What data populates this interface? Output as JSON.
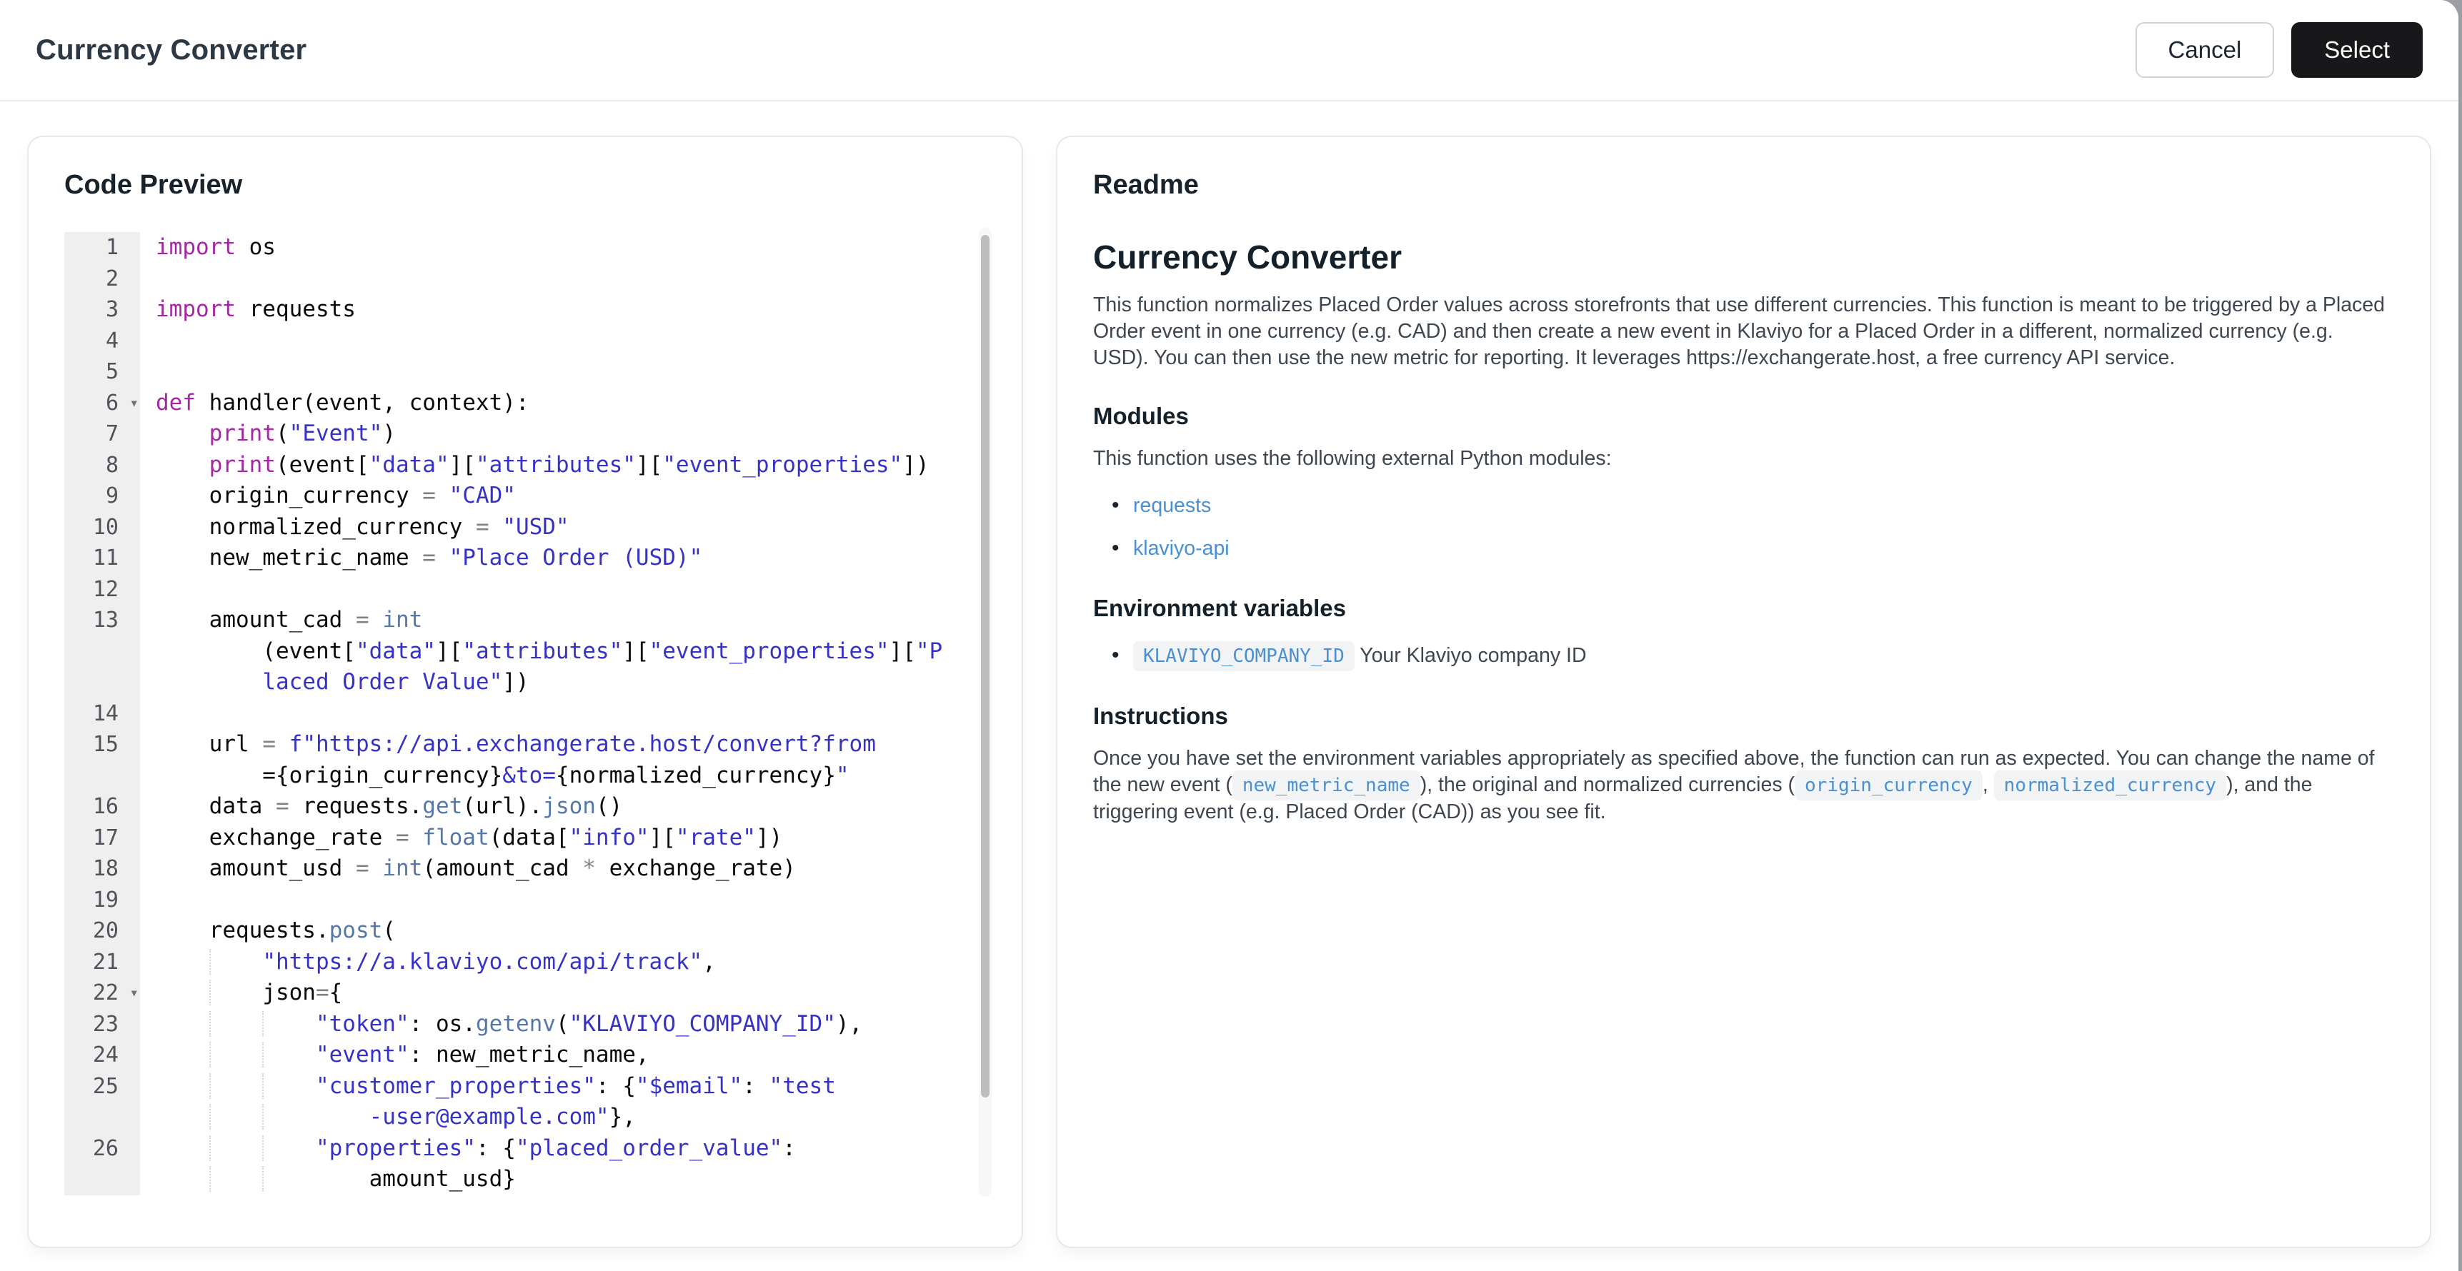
{
  "header": {
    "title": "Currency Converter",
    "cancel_label": "Cancel",
    "select_label": "Select"
  },
  "code": {
    "panel_title": "Code Preview",
    "rows": [
      {
        "n": "1",
        "segs": [
          [
            "k",
            "import"
          ],
          [
            "p",
            " os"
          ]
        ]
      },
      {
        "n": "2",
        "segs": []
      },
      {
        "n": "3",
        "segs": [
          [
            "k",
            "import"
          ],
          [
            "p",
            " requests"
          ]
        ]
      },
      {
        "n": "4",
        "segs": []
      },
      {
        "n": "5",
        "segs": []
      },
      {
        "n": "6",
        "fold": true,
        "segs": [
          [
            "k",
            "def"
          ],
          [
            "p",
            " handler(event, context):"
          ]
        ]
      },
      {
        "n": "7",
        "segs": [
          [
            "p",
            "    "
          ],
          [
            "k",
            "print"
          ],
          [
            "p",
            "("
          ],
          [
            "s",
            "\"Event\""
          ],
          [
            "p",
            ")"
          ]
        ]
      },
      {
        "n": "8",
        "segs": [
          [
            "p",
            "    "
          ],
          [
            "k",
            "print"
          ],
          [
            "p",
            "(event["
          ],
          [
            "s",
            "\"data\""
          ],
          [
            "p",
            "]["
          ],
          [
            "s",
            "\"attributes\""
          ],
          [
            "p",
            "]["
          ],
          [
            "s",
            "\"event_properties\""
          ],
          [
            "p",
            "])"
          ]
        ]
      },
      {
        "n": "9",
        "segs": [
          [
            "p",
            "    origin_currency "
          ],
          [
            "o",
            "="
          ],
          [
            "p",
            " "
          ],
          [
            "s",
            "\"CAD\""
          ]
        ]
      },
      {
        "n": "10",
        "segs": [
          [
            "p",
            "    normalized_currency "
          ],
          [
            "o",
            "="
          ],
          [
            "p",
            " "
          ],
          [
            "s",
            "\"USD\""
          ]
        ]
      },
      {
        "n": "11",
        "segs": [
          [
            "p",
            "    new_metric_name "
          ],
          [
            "o",
            "="
          ],
          [
            "p",
            " "
          ],
          [
            "s",
            "\"Place Order (USD)\""
          ]
        ]
      },
      {
        "n": "12",
        "segs": []
      },
      {
        "n": "13",
        "segs": [
          [
            "p",
            "    amount_cad "
          ],
          [
            "o",
            "="
          ],
          [
            "p",
            " "
          ],
          [
            "b",
            "int"
          ]
        ]
      },
      {
        "n": "",
        "segs": [
          [
            "p",
            "        (event["
          ],
          [
            "s",
            "\"data\""
          ],
          [
            "p",
            "]["
          ],
          [
            "s",
            "\"attributes\""
          ],
          [
            "p",
            "]["
          ],
          [
            "s",
            "\"event_properties\""
          ],
          [
            "p",
            "]["
          ],
          [
            "s",
            "\"P"
          ]
        ]
      },
      {
        "n": "",
        "segs": [
          [
            "p",
            "        "
          ],
          [
            "s",
            "laced Order Value\""
          ],
          [
            "p",
            "])"
          ]
        ]
      },
      {
        "n": "14",
        "segs": []
      },
      {
        "n": "15",
        "segs": [
          [
            "p",
            "    url "
          ],
          [
            "o",
            "="
          ],
          [
            "p",
            " "
          ],
          [
            "s",
            "f\"https://api.exchangerate.host/convert?from"
          ]
        ]
      },
      {
        "n": "",
        "segs": [
          [
            "p",
            "        ={origin_currency}"
          ],
          [
            "s",
            "&to="
          ],
          [
            "p",
            "{normalized_currency}"
          ],
          [
            "s",
            "\""
          ]
        ]
      },
      {
        "n": "16",
        "segs": [
          [
            "p",
            "    data "
          ],
          [
            "o",
            "="
          ],
          [
            "p",
            " requests."
          ],
          [
            "b",
            "get"
          ],
          [
            "p",
            "(url)."
          ],
          [
            "b",
            "json"
          ],
          [
            "p",
            "()"
          ]
        ]
      },
      {
        "n": "17",
        "segs": [
          [
            "p",
            "    exchange_rate "
          ],
          [
            "o",
            "="
          ],
          [
            "p",
            " "
          ],
          [
            "b",
            "float"
          ],
          [
            "p",
            "(data["
          ],
          [
            "s",
            "\"info\""
          ],
          [
            "p",
            "]["
          ],
          [
            "s",
            "\"rate\""
          ],
          [
            "p",
            "])"
          ]
        ]
      },
      {
        "n": "18",
        "segs": [
          [
            "p",
            "    amount_usd "
          ],
          [
            "o",
            "="
          ],
          [
            "p",
            " "
          ],
          [
            "b",
            "int"
          ],
          [
            "p",
            "(amount_cad "
          ],
          [
            "o",
            "*"
          ],
          [
            "p",
            " exchange_rate)"
          ]
        ]
      },
      {
        "n": "19",
        "segs": []
      },
      {
        "n": "20",
        "segs": [
          [
            "p",
            "    requests."
          ],
          [
            "b",
            "post"
          ],
          [
            "p",
            "("
          ]
        ]
      },
      {
        "n": "21",
        "segs": [
          [
            "p",
            "    "
          ],
          [
            "g",
            "    "
          ],
          [
            "s",
            "\"https://a.klaviyo.com/api/track\""
          ],
          [
            "p",
            ","
          ]
        ]
      },
      {
        "n": "22",
        "fold": true,
        "segs": [
          [
            "p",
            "    "
          ],
          [
            "g",
            "    "
          ],
          [
            "p",
            "json"
          ],
          [
            "o",
            "="
          ],
          [
            "p",
            "{"
          ]
        ]
      },
      {
        "n": "23",
        "segs": [
          [
            "p",
            "    "
          ],
          [
            "g",
            "    "
          ],
          [
            "g",
            "    "
          ],
          [
            "s",
            "\"token\""
          ],
          [
            "p",
            ": os."
          ],
          [
            "b",
            "getenv"
          ],
          [
            "p",
            "("
          ],
          [
            "s",
            "\"KLAVIYO_COMPANY_ID\""
          ],
          [
            "p",
            "),"
          ]
        ]
      },
      {
        "n": "24",
        "segs": [
          [
            "p",
            "    "
          ],
          [
            "g",
            "    "
          ],
          [
            "g",
            "    "
          ],
          [
            "s",
            "\"event\""
          ],
          [
            "p",
            ": new_metric_name,"
          ]
        ]
      },
      {
        "n": "25",
        "segs": [
          [
            "p",
            "    "
          ],
          [
            "g",
            "    "
          ],
          [
            "g",
            "    "
          ],
          [
            "s",
            "\"customer_properties\""
          ],
          [
            "p",
            ": {"
          ],
          [
            "s",
            "\"$email\""
          ],
          [
            "p",
            ": "
          ],
          [
            "s",
            "\"test"
          ]
        ]
      },
      {
        "n": "",
        "segs": [
          [
            "p",
            "    "
          ],
          [
            "g",
            "    "
          ],
          [
            "g",
            "    "
          ],
          [
            "p",
            "    "
          ],
          [
            "s",
            "-user@example.com\""
          ],
          [
            "p",
            "},"
          ]
        ]
      },
      {
        "n": "26",
        "segs": [
          [
            "p",
            "    "
          ],
          [
            "g",
            "    "
          ],
          [
            "g",
            "    "
          ],
          [
            "s",
            "\"properties\""
          ],
          [
            "p",
            ": {"
          ],
          [
            "s",
            "\"placed_order_value\""
          ],
          [
            "p",
            ":"
          ]
        ]
      },
      {
        "n": "",
        "segs": [
          [
            "p",
            "    "
          ],
          [
            "g",
            "    "
          ],
          [
            "g",
            "    "
          ],
          [
            "p",
            "    amount_usd}"
          ]
        ]
      }
    ]
  },
  "readme": {
    "panel_title": "Readme",
    "title": "Currency Converter",
    "intro": "This function normalizes Placed Order values across storefronts that use different currencies. This function is meant to be triggered by a Placed Order event in one currency (e.g. CAD) and then create a new event in Klaviyo for a Placed Order in a different, normalized currency (e.g. USD). You can then use the new metric for reporting. It leverages https://exchangerate.host, a free currency API service.",
    "modules": {
      "heading": "Modules",
      "intro": "This function uses the following external Python modules:",
      "items": [
        "requests",
        "klaviyo-api"
      ]
    },
    "env": {
      "heading": "Environment variables",
      "var_name": "KLAVIYO_COMPANY_ID",
      "var_desc": "Your Klaviyo company ID"
    },
    "instructions": {
      "heading": "Instructions",
      "parts": [
        {
          "t": "Once you have set the environment variables appropriately as specified above, the function can run as expected. You can change the name of the new event ("
        },
        {
          "chip": "new_metric_name"
        },
        {
          "t": "), the original and normalized currencies ("
        },
        {
          "chip": "origin_currency"
        },
        {
          "t": ", "
        },
        {
          "chip": "normalized_currency"
        },
        {
          "t": "), and the triggering event (e.g. Placed Order (CAD)) as you see fit."
        }
      ]
    }
  },
  "colors": {
    "keyword": "#a626a4",
    "string": "#3632c8",
    "builtin": "#5578a8",
    "link": "#4a90d0",
    "select_button": "#18181b"
  }
}
